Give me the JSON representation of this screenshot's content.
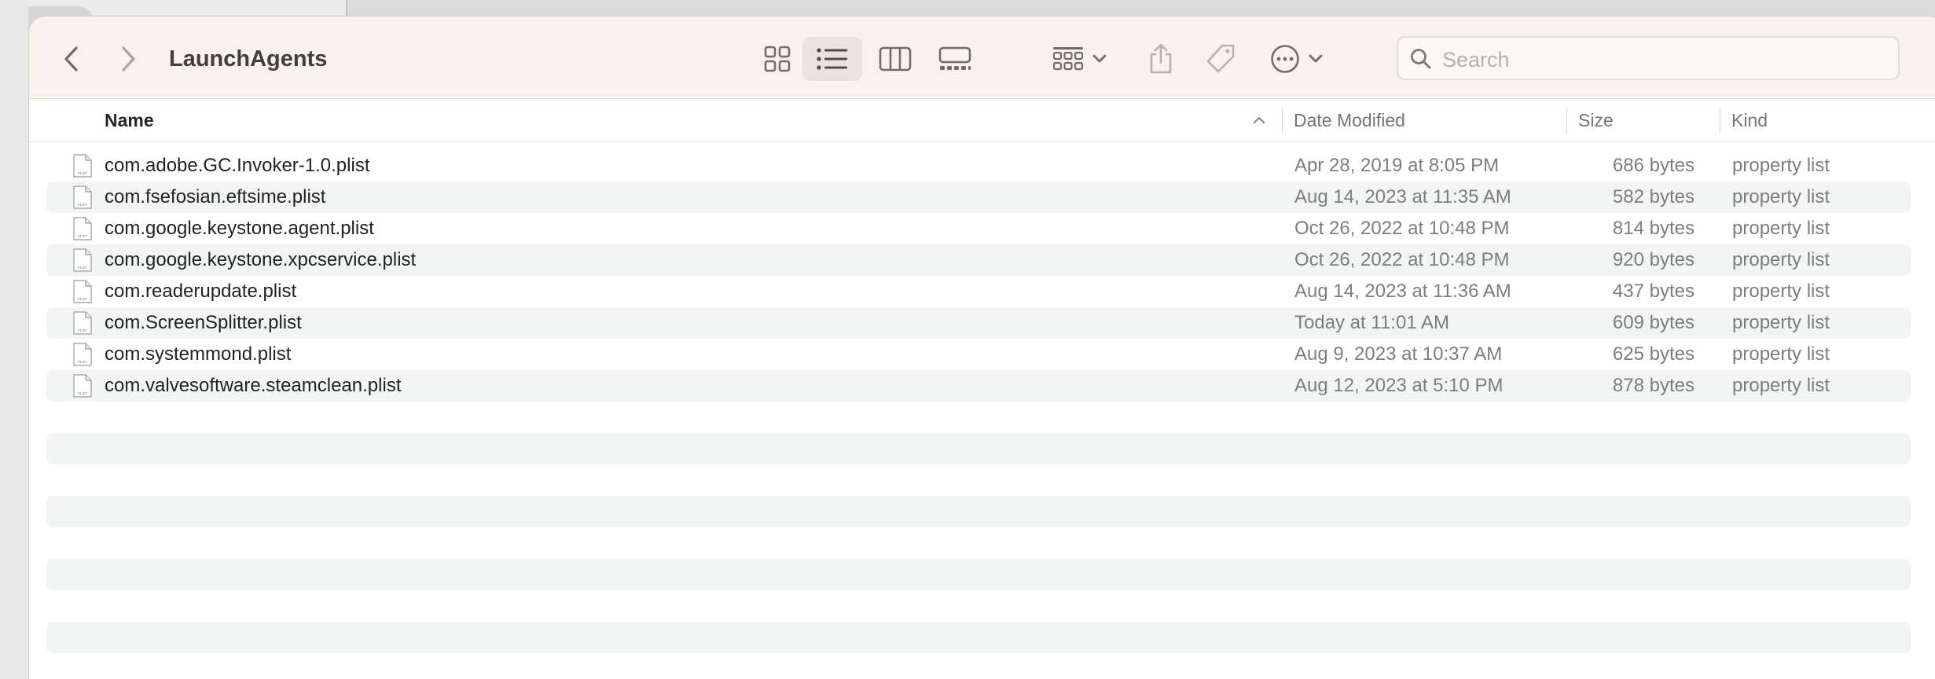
{
  "window": {
    "title": "LaunchAgents"
  },
  "toolbar": {
    "back_icon": "chevron-left-icon",
    "forward_icon": "chevron-right-icon",
    "views": [
      "icon-view",
      "list-view",
      "column-view",
      "gallery-view"
    ],
    "active_view": "list-view"
  },
  "search": {
    "placeholder": "Search",
    "value": ""
  },
  "columns": {
    "name": "Name",
    "date": "Date Modified",
    "size": "Size",
    "kind": "Kind"
  },
  "files": [
    {
      "name": "com.adobe.GC.Invoker-1.0.plist",
      "date": "Apr 28, 2019 at 8:05 PM",
      "size": "686 bytes",
      "kind": "property list"
    },
    {
      "name": "com.fsefosian.eftsime.plist",
      "date": "Aug 14, 2023 at 11:35 AM",
      "size": "582 bytes",
      "kind": "property list"
    },
    {
      "name": "com.google.keystone.agent.plist",
      "date": "Oct 26, 2022 at 10:48 PM",
      "size": "814 bytes",
      "kind": "property list"
    },
    {
      "name": "com.google.keystone.xpcservice.plist",
      "date": "Oct 26, 2022 at 10:48 PM",
      "size": "920 bytes",
      "kind": "property list"
    },
    {
      "name": "com.readerupdate.plist",
      "date": "Aug 14, 2023 at 11:36 AM",
      "size": "437 bytes",
      "kind": "property list"
    },
    {
      "name": "com.ScreenSplitter.plist",
      "date": "Today at 11:01 AM",
      "size": "609 bytes",
      "kind": "property list"
    },
    {
      "name": "com.systemmond.plist",
      "date": "Aug 9, 2023 at 10:37 AM",
      "size": "625 bytes",
      "kind": "property list"
    },
    {
      "name": "com.valvesoftware.steamclean.plist",
      "date": "Aug 12, 2023 at 5:10 PM",
      "size": "878 bytes",
      "kind": "property list"
    }
  ],
  "file_icon_label": "PLIST",
  "colors": {
    "toolbar_bg": "#f8f1ec",
    "alt_row": "#f3f4f4",
    "active_view_bg": "#e9e2dd"
  }
}
